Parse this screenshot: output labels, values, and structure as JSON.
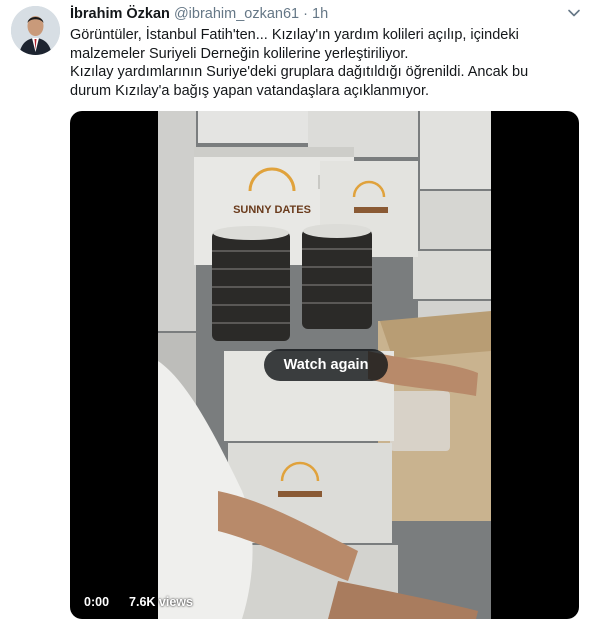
{
  "tweet": {
    "author_name": "İbrahim Özkan",
    "handle": "@ibrahim_ozkan61",
    "separator": "·",
    "time": "1h",
    "lines": [
      "Görüntüler, İstanbul Fatih'ten... Kızılay'ın yardım kolileri açılıp, içindeki",
      "malzemeler Suriyeli Derneğin kolilerine yerleştiriliyor.",
      "Kızılay yardımlarının Suriye'deki gruplara dağıtıldığı öğrenildi. Ancak bu",
      "durum Kızılay'a bağış yapan vatandaşlara açıklanmıyor."
    ]
  },
  "video": {
    "overlay_label": "Watch again",
    "current_time": "0:00",
    "views": "7.6K views",
    "box_brand": "SUNNY DATES"
  },
  "colors": {
    "muted": "#657786",
    "text": "#14171a",
    "cardboard": "#c9b38f"
  }
}
